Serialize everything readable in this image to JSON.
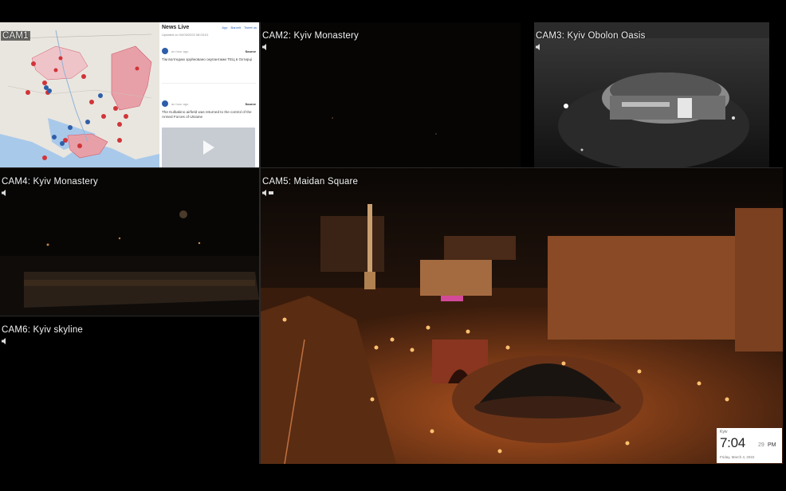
{
  "cameras": {
    "cam1": {
      "label": "CAM1"
    },
    "cam2": {
      "label": "CAM2: Kyiv Monastery"
    },
    "cam3": {
      "label": "CAM3: Kyiv Obolon Oasis"
    },
    "cam4": {
      "label": "CAM4: Kyiv Monastery"
    },
    "cam5": {
      "label": "CAM5: Maidan Square"
    },
    "cam6": {
      "label": "CAM6: Kyiv skyline"
    }
  },
  "news": {
    "title": "News Live",
    "nav": [
      "App",
      "Barcelt",
      "Tweet us"
    ],
    "updated": "Updated on 04/03/2022 08:03:01",
    "items": [
      {
        "time": "an hour ago",
        "source": "Source",
        "text": "Тім волтедаю зруйновано окупантами ТЕЦ в Охтирці"
      },
      {
        "time": "an hour ago",
        "source": "Source",
        "text": "The Kulbakino airfield was returned to the control of the Armed Forces of Ukraine"
      }
    ]
  },
  "clock": {
    "city": "Kyiv",
    "time": "7:04",
    "seconds": "29",
    "ampm": "PM",
    "date": "Friday, March 4, 2022"
  },
  "colors": {
    "map_land": "#e9e6df",
    "map_water": "#a9c9ea",
    "map_occupied": "#e8a0a8",
    "news_accent": "#2f5ea8",
    "night_glow": "#c86a2a"
  }
}
